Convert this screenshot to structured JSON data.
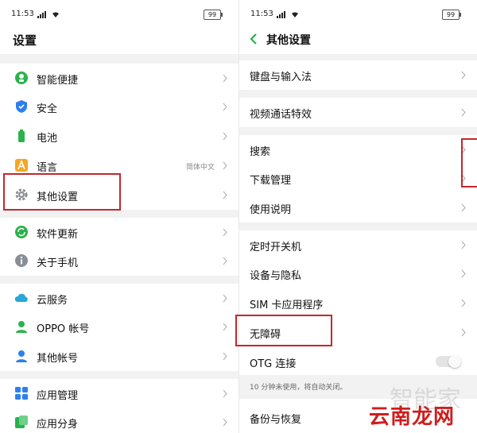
{
  "status": {
    "time": "11:53",
    "battery": "99"
  },
  "left": {
    "title": "设置",
    "items": [
      {
        "label": "智能便捷",
        "icon": "smart-assist-icon"
      },
      {
        "label": "安全",
        "icon": "shield-icon"
      },
      {
        "label": "电池",
        "icon": "battery-icon"
      },
      {
        "label": "语言",
        "value": "简体中文",
        "icon": "language-icon"
      },
      {
        "label": "其他设置",
        "icon": "gear-icon"
      },
      {
        "label": "软件更新",
        "icon": "update-icon"
      },
      {
        "label": "关于手机",
        "icon": "info-icon"
      },
      {
        "label": "云服务",
        "icon": "cloud-icon"
      },
      {
        "label": "OPPO 帐号",
        "icon": "person-icon"
      },
      {
        "label": "其他帐号",
        "icon": "account-icon"
      },
      {
        "label": "应用管理",
        "icon": "apps-icon"
      },
      {
        "label": "应用分身",
        "icon": "app-clone-icon"
      }
    ]
  },
  "right": {
    "title": "其他设置",
    "items": [
      {
        "label": "键盘与输入法"
      },
      {
        "label": "视频通话特效"
      },
      {
        "label": "搜索"
      },
      {
        "label": "下载管理"
      },
      {
        "label": "使用说明"
      },
      {
        "label": "定时开关机"
      },
      {
        "label": "设备与隐私"
      },
      {
        "label": "SIM 卡应用程序"
      },
      {
        "label": "无障碍"
      },
      {
        "label": "OTG 连接"
      },
      {
        "label": "备份与恢复"
      }
    ],
    "otg_hint": "10 分钟未使用，将自动关闭。",
    "otg_enabled": false
  },
  "watermark": {
    "main": "云南龙网",
    "faint": "智能家"
  },
  "colors": {
    "accent": "#2bb24c",
    "highlight": "#c0282d",
    "gap": "#f2f2f2"
  }
}
